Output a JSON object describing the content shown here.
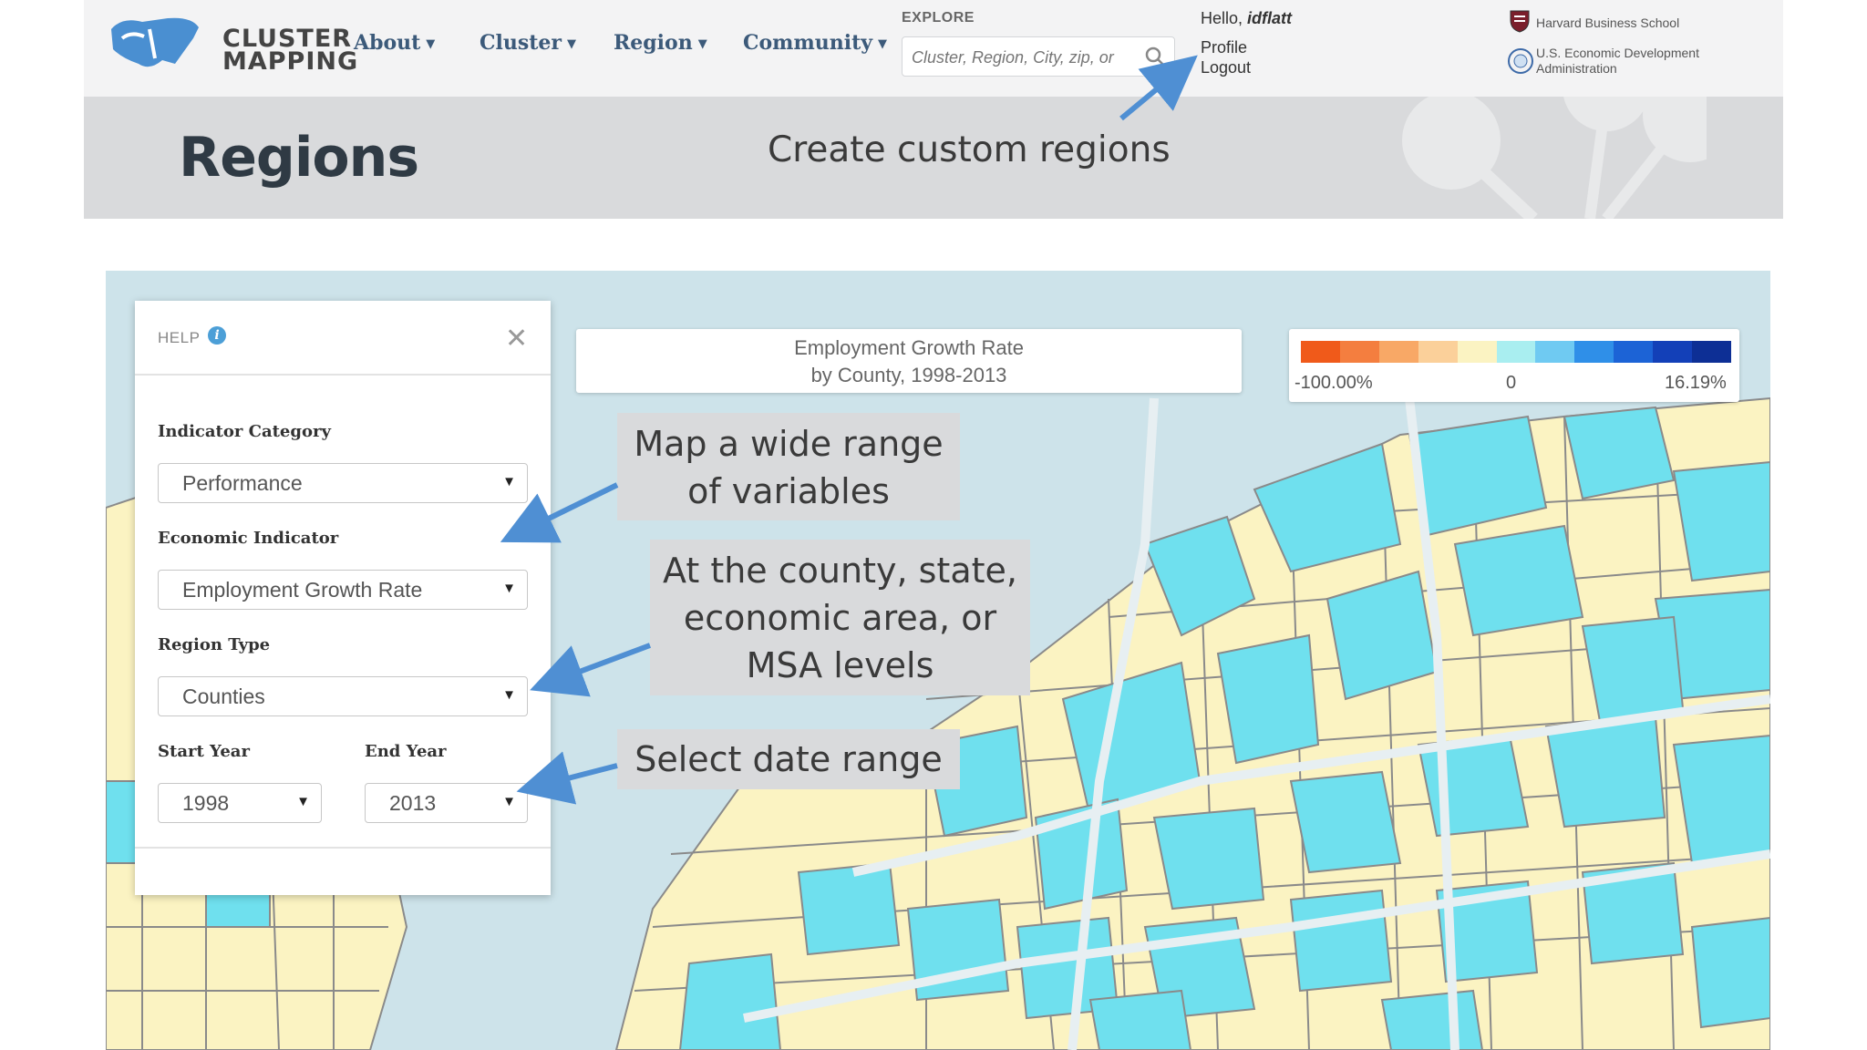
{
  "app": {
    "logo_line1": "CLUSTER",
    "logo_line2": "MAPPING",
    "logo_mark": "US"
  },
  "nav": {
    "items": [
      {
        "label": "About"
      },
      {
        "label": "Cluster"
      },
      {
        "label": "Region"
      },
      {
        "label": "Community"
      }
    ]
  },
  "explore": {
    "label": "EXPLORE",
    "placeholder": "Cluster, Region, City, zip, or"
  },
  "user": {
    "greeting": "Hello,",
    "name": "idflatt",
    "profile": "Profile",
    "logout": "Logout"
  },
  "partners": {
    "hbs": "Harvard Business School",
    "eda_line1": "U.S. Economic Development",
    "eda_line2": "Administration"
  },
  "banner": {
    "title": "Regions",
    "callout": "Create custom regions"
  },
  "help_panel": {
    "title": "HELP",
    "indicator_category_label": "Indicator Category",
    "indicator_category_value": "Performance",
    "economic_indicator_label": "Economic Indicator",
    "economic_indicator_value": "Employment Growth Rate",
    "region_type_label": "Region Type",
    "region_type_value": "Counties",
    "start_year_label": "Start Year",
    "start_year_value": "1998",
    "end_year_label": "End Year",
    "end_year_value": "2013"
  },
  "map": {
    "title_line1": "Employment Growth Rate",
    "title_line2": "by County, 1998-2013",
    "legend": {
      "min": "-100.00%",
      "mid": "0",
      "max": "16.19%",
      "colors": [
        "#f05a1a",
        "#f47e3f",
        "#f8a866",
        "#fbd09a",
        "#fbf3c2",
        "#a9eef0",
        "#6fcaf2",
        "#2f8fe8",
        "#1c63d6",
        "#1340b8",
        "#0d2f95"
      ]
    }
  },
  "annotations": {
    "variables_line1": "Map a wide range",
    "variables_line2": "of variables",
    "levels_line1": "At the county, state,",
    "levels_line2": "economic area, or",
    "levels_line3": "MSA levels",
    "dates": "Select date range"
  }
}
